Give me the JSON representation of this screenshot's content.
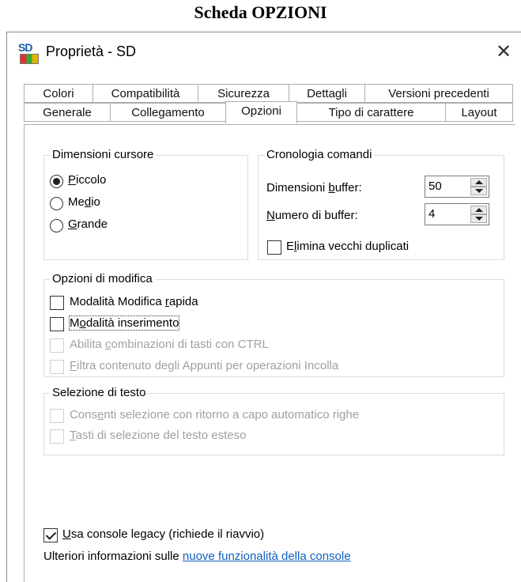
{
  "caption": "Scheda OPZIONI",
  "window": {
    "title": "Proprietà - SD",
    "icon_text": "SD",
    "close_label": "✕"
  },
  "tabs_row1": [
    {
      "label": "Colori"
    },
    {
      "label": "Compatibilità"
    },
    {
      "label": "Sicurezza"
    },
    {
      "label": "Dettagli"
    },
    {
      "label": "Versioni precedenti"
    }
  ],
  "tabs_row2": [
    {
      "label": "Generale"
    },
    {
      "label": "Collegamento"
    },
    {
      "label": "Opzioni",
      "active": true
    },
    {
      "label": "Tipo di carattere"
    },
    {
      "label": "Layout"
    }
  ],
  "cursor_size": {
    "legend": "Dimensioni cursore",
    "options": [
      {
        "pre": "",
        "u": "P",
        "post": "iccolo",
        "checked": true
      },
      {
        "pre": "Me",
        "u": "d",
        "post": "io",
        "checked": false
      },
      {
        "pre": "",
        "u": "G",
        "post": "rande",
        "checked": false
      }
    ]
  },
  "history": {
    "legend": "Cronologia comandi",
    "buffer_size": {
      "pre": "Dimensioni ",
      "u": "b",
      "post": "uffer:",
      "value": "50"
    },
    "buffer_count": {
      "pre": "",
      "u": "N",
      "post": "umero di buffer:",
      "value": "4"
    },
    "dedupe": {
      "pre": "E",
      "u": "l",
      "post": "imina vecchi duplicati",
      "checked": false
    }
  },
  "edit_options": {
    "legend": "Opzioni di modifica",
    "items": [
      {
        "pre": "Modalità Modifica ",
        "u": "r",
        "post": "apida",
        "checked": false,
        "disabled": false
      },
      {
        "pre": "M",
        "u": "o",
        "post": "dalità inserimento",
        "checked": false,
        "disabled": false
      },
      {
        "pre": "Abilita ",
        "u": "c",
        "post": "ombinazioni di tasti con CTRL",
        "checked": false,
        "disabled": true
      },
      {
        "pre": "",
        "u": "F",
        "post": "iltra contenuto degli Appunti per operazioni Incolla",
        "checked": false,
        "disabled": true
      }
    ]
  },
  "text_selection": {
    "legend": "Selezione di testo",
    "items": [
      {
        "pre": "Cons",
        "u": "e",
        "post": "nti selezione con ritorno a capo automatico righe",
        "checked": false,
        "disabled": true
      },
      {
        "pre": "",
        "u": "T",
        "post": "asti di selezione del testo esteso",
        "checked": false,
        "disabled": true
      }
    ]
  },
  "legacy": {
    "pre": "",
    "u": "U",
    "post": "sa console legacy (richiede il riavvio)",
    "checked": true
  },
  "info": {
    "text": "Ulteriori informazioni sulle ",
    "link": "nuove funzionalità della console"
  }
}
